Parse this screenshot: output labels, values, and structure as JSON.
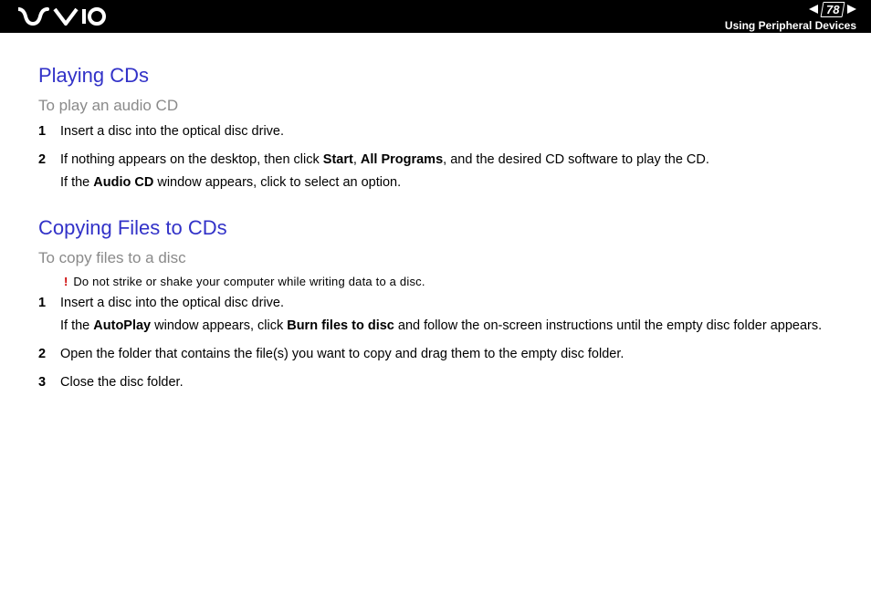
{
  "header": {
    "page_number": "78",
    "section": "Using Peripheral Devices"
  },
  "sections": {
    "playing": {
      "title": "Playing CDs",
      "subtitle": "To play an audio CD",
      "step1": "Insert a disc into the optical disc drive.",
      "step2_prefix": "If nothing appears on the desktop, then click ",
      "step2_b1": "Start",
      "step2_sep1": ", ",
      "step2_b2": "All Programs",
      "step2_suffix": ", and the desired CD software to play the CD.",
      "step2_line2_prefix": "If the ",
      "step2_line2_b": "Audio CD",
      "step2_line2_suffix": " window appears, click to select an option."
    },
    "copying": {
      "title": "Copying Files to CDs",
      "subtitle": "To copy files to a disc",
      "caution": "Do not strike or shake your computer while writing data to a disc.",
      "step1_line1": "Insert a disc into the optical disc drive.",
      "step1_line2_prefix": "If the ",
      "step1_line2_b1": "AutoPlay",
      "step1_line2_mid": " window appears, click ",
      "step1_line2_b2": "Burn files to disc",
      "step1_line2_suffix": " and follow the on-screen instructions until the empty disc folder appears.",
      "step2": "Open the folder that contains the file(s) you want to copy and drag them to the empty disc folder.",
      "step3": "Close the disc folder."
    }
  },
  "numbers": {
    "n1": "1",
    "n2": "2",
    "n3": "3"
  }
}
